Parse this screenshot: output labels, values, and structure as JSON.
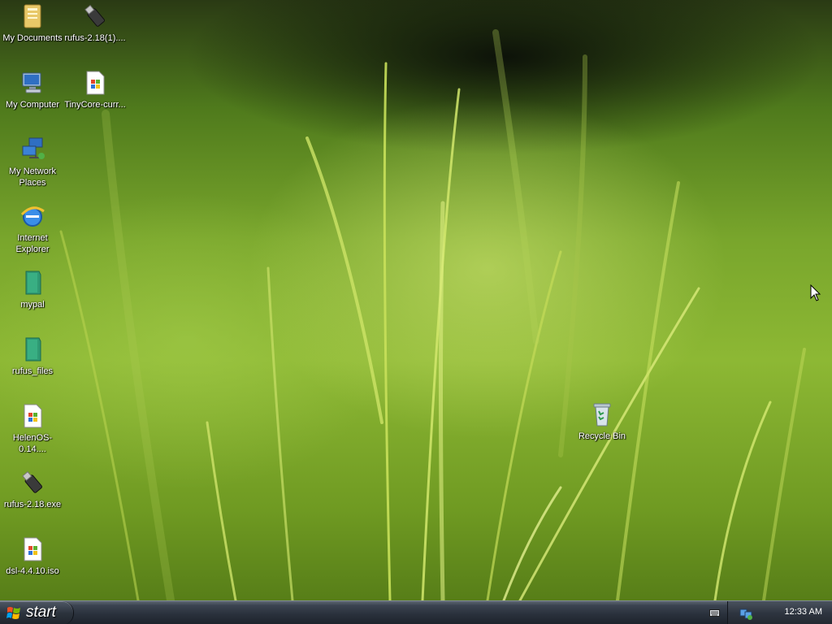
{
  "desktop": {
    "icons": [
      {
        "label": "My Documents",
        "icon": "my-documents-folder-icon"
      },
      {
        "label": "rufus-2.18(1)....",
        "icon": "usb-drive-icon"
      },
      {
        "label": "My Computer",
        "icon": "my-computer-icon"
      },
      {
        "label": "TinyCore-curr...",
        "icon": "iso-file-icon"
      },
      {
        "label": "My Network Places",
        "icon": "network-places-icon"
      },
      {
        "label": "Internet Explorer",
        "icon": "internet-explorer-icon"
      },
      {
        "label": "mypal",
        "icon": "green-folder-icon"
      },
      {
        "label": "rufus_files",
        "icon": "green-folder-icon"
      },
      {
        "label": "HelenOS-0.14....",
        "icon": "iso-file-icon"
      },
      {
        "label": "rufus-2.18.exe",
        "icon": "usb-drive-icon"
      },
      {
        "label": "dsl-4.4.10.iso",
        "icon": "iso-file-icon"
      },
      {
        "label": "Recycle Bin",
        "icon": "recycle-bin-icon"
      }
    ]
  },
  "taskbar": {
    "start_label": "start",
    "clock": "12:33 AM"
  },
  "colors": {
    "taskbar": "#2a313c",
    "label_text": "#ffffff"
  }
}
